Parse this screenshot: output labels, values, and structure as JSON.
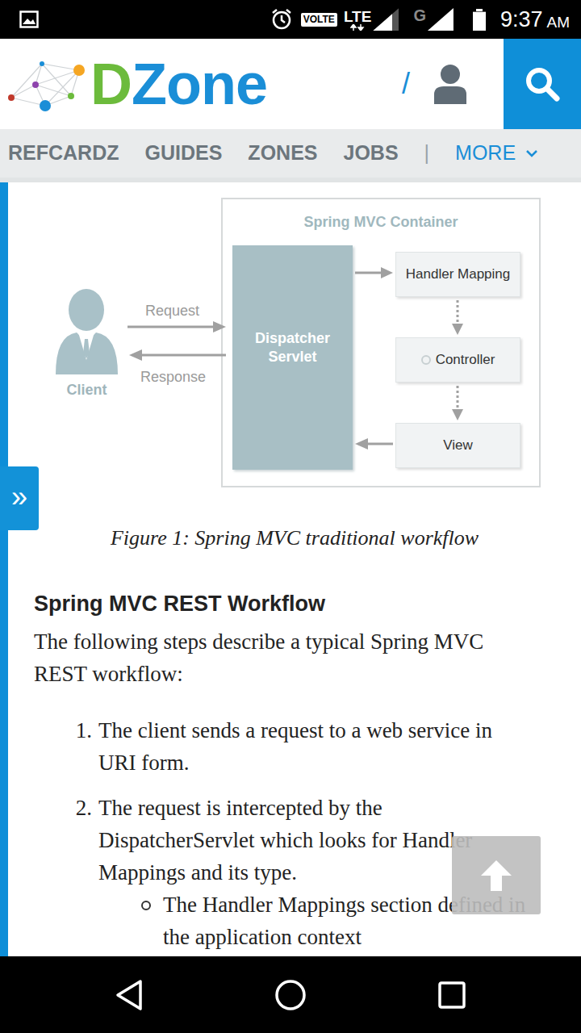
{
  "status_bar": {
    "volte": "VOLTE",
    "lte": "LTE",
    "network": "G",
    "time": "9:37",
    "ampm": "AM",
    "signal_lte": {
      "level": 0.75
    },
    "signal_g": {
      "level": 1
    },
    "battery": {
      "level": 0.95
    }
  },
  "header": {
    "logo": [
      "D",
      "Zone"
    ],
    "divider": "/"
  },
  "nav": {
    "items": [
      "REFCARDZ",
      "GUIDES",
      "ZONES",
      "JOBS"
    ],
    "separator": "|",
    "more": "MORE"
  },
  "figure": {
    "container_title": "Spring MVC Container",
    "client": "Client",
    "request": "Request",
    "response": "Response",
    "dispatcher": "Dispatcher Servlet",
    "steps": [
      "Handler Mapping",
      "Controller",
      "View"
    ],
    "caption": "Figure 1: Spring MVC traditional workflow"
  },
  "article": {
    "heading": "Spring MVC REST Workflow",
    "intro": "The following steps describe a typical Spring MVC REST workflow:",
    "steps": [
      {
        "number": "1.",
        "text": "The client sends a request to a web service in URI form."
      },
      {
        "number": "2.",
        "text": "The request is intercepted by the DispatcherServlet which looks for Handler Mappings and its type.",
        "sub": [
          "The Handler Mappings section defined in the application context"
        ]
      }
    ]
  },
  "side_tab": "»"
}
